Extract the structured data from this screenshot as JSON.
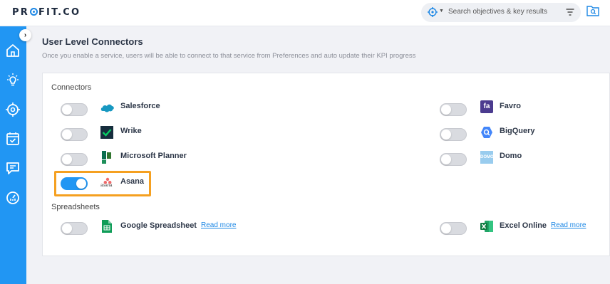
{
  "header": {
    "brand": "PROFIT.CO",
    "brand_pre": "PR",
    "brand_post": "FIT.CO",
    "search_placeholder": "Search objectives & key results"
  },
  "page": {
    "title": "User Level Connectors",
    "subtitle": "Once you enable a service, users will be able to connect to that service from Preferences and auto update their KPI progress"
  },
  "sections": {
    "connectors_label": "Connectors",
    "spreadsheets_label": "Spreadsheets"
  },
  "connectors": {
    "salesforce": {
      "name": "Salesforce",
      "enabled": false
    },
    "wrike": {
      "name": "Wrike",
      "enabled": false
    },
    "planner": {
      "name": "Microsoft Planner",
      "enabled": false
    },
    "asana": {
      "name": "Asana",
      "enabled": true,
      "logo_text": "asana"
    },
    "favro": {
      "name": "Favro",
      "enabled": false,
      "logo_text": "fa"
    },
    "bigquery": {
      "name": "BigQuery",
      "enabled": false
    },
    "domo": {
      "name": "Domo",
      "enabled": false,
      "logo_text": "DOMO"
    }
  },
  "spreadsheets": {
    "google": {
      "name": "Google Spreadsheet",
      "enabled": false,
      "read_more": "Read more"
    },
    "excel": {
      "name": "Excel Online",
      "enabled": false,
      "read_more": "Read more"
    }
  },
  "colors": {
    "accent": "#2196f3",
    "highlight": "#f5a020",
    "sidebar": "#2196f3"
  },
  "icons": [
    "home-icon",
    "bulb-icon",
    "target-icon",
    "calendar-check-icon",
    "chat-icon",
    "dashboard-icon",
    "search-scope-icon",
    "filter-icon",
    "folder-search-icon"
  ]
}
